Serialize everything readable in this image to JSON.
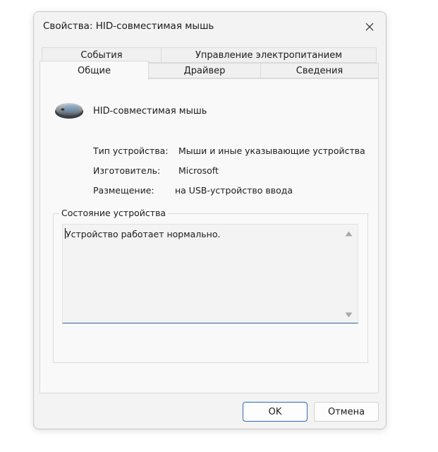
{
  "window": {
    "title": "Свойства: HID-совместимая мышь"
  },
  "tabs": {
    "back": [
      {
        "label": "События"
      },
      {
        "label": "Управление электропитанием"
      }
    ],
    "front": [
      {
        "label": "Общие"
      },
      {
        "label": "Драйвер"
      },
      {
        "label": "Сведения"
      }
    ]
  },
  "general": {
    "device_name": "HID-совместимая мышь",
    "properties": [
      {
        "label": "Тип устройства:",
        "value": "Мыши и иные указывающие устройства"
      },
      {
        "label": "Изготовитель:",
        "value": "Microsoft"
      },
      {
        "label": "Размещение:",
        "value": "на USB-устройство ввода"
      }
    ],
    "status_group_title": "Состояние устройства",
    "status_text": "Устройство работает нормально."
  },
  "buttons": {
    "ok": "OK",
    "cancel": "Отмена"
  },
  "colors": {
    "accent": "#2e6bb5",
    "window_bg": "#f3f3f3",
    "panel_bg": "#f9f9f9"
  },
  "icons": {
    "close": "close-icon",
    "device": "mouse-icon",
    "scroll_up": "scroll-up-arrow-icon",
    "scroll_down": "scroll-down-arrow-icon"
  }
}
